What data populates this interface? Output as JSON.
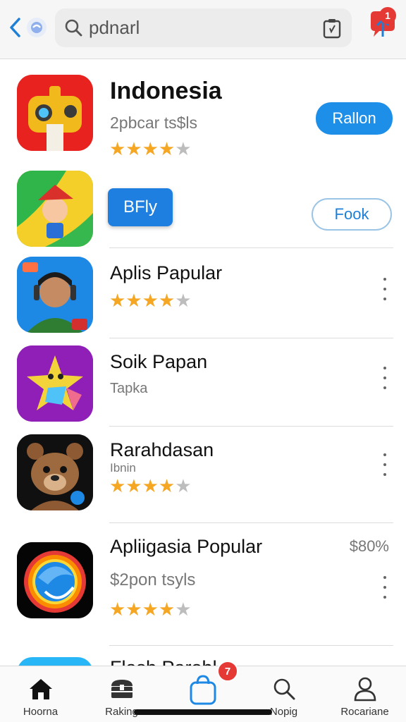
{
  "header": {
    "search_value": "pdnarl",
    "notification_count": "1"
  },
  "apps": [
    {
      "title": "Indonesia",
      "subtitle": "2pbcar ts$ls",
      "rating": 4,
      "button": "Rallon"
    },
    {
      "title": "",
      "badge_button": "BFly",
      "button": "Fook"
    },
    {
      "title": "Aplis Papular",
      "rating": 4
    },
    {
      "title": "Soik Papan",
      "subtitle": "Tapka"
    },
    {
      "title": "Rarahdasan",
      "subtitle": "Ibnin",
      "rating": 4
    },
    {
      "title": "Apliigasia Popular",
      "subtitle": "$2pon tsyls",
      "price": "$80%",
      "rating": 4
    },
    {
      "title": "Flash Parobl"
    }
  ],
  "bottom_nav": {
    "items": [
      {
        "label": "Hoorna",
        "icon": "home-icon"
      },
      {
        "label": "Raking",
        "icon": "treasure-chest-icon"
      },
      {
        "label": "",
        "icon": "shopping-bag-icon",
        "badge": "7"
      },
      {
        "label": "Nopig",
        "icon": "search-icon"
      },
      {
        "label": "Rocariane",
        "icon": "profile-icon"
      }
    ]
  },
  "colors": {
    "accent": "#1e8fe8",
    "star": "#f5a623",
    "badge": "#e53935"
  }
}
